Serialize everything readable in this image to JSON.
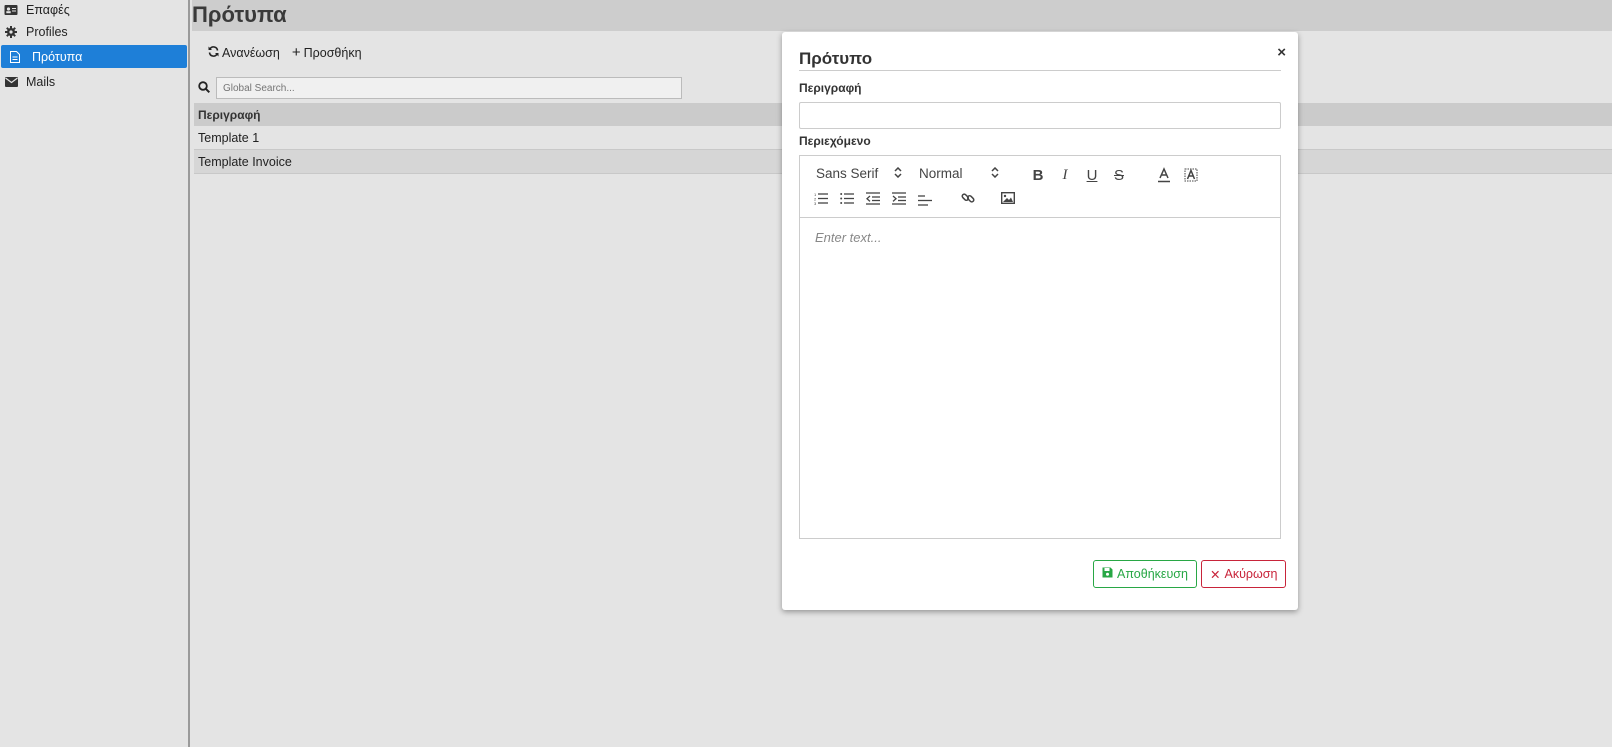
{
  "sidebar": {
    "items": [
      {
        "label": "Επαφές",
        "icon": "address-card-icon"
      },
      {
        "label": "Profiles",
        "icon": "gear-icon"
      },
      {
        "label": "Πρότυπα",
        "icon": "file-icon",
        "active": true
      },
      {
        "label": "Mails",
        "icon": "envelope-icon"
      }
    ]
  },
  "main": {
    "title": "Πρότυπα",
    "toolbar": {
      "refresh_label": "Ανανέωση",
      "add_label": "Προσθήκη"
    },
    "search": {
      "placeholder": "Global Search..."
    },
    "table": {
      "header": "Περιγραφή",
      "rows": [
        "Template 1",
        "Template Invoice"
      ]
    }
  },
  "modal": {
    "title": "Πρότυπο",
    "close": "×",
    "description_label": "Περιγραφή",
    "description_value": "",
    "content_label": "Περιεχόμενο",
    "editor": {
      "font_select": "Sans Serif",
      "size_select": "Normal",
      "placeholder": "Enter text..."
    },
    "save_label": "Αποθήκευση",
    "cancel_label": "Ακύρωση"
  },
  "colors": {
    "accent": "#1e7fd8",
    "save": "#28a745",
    "cancel": "#c8243a"
  }
}
